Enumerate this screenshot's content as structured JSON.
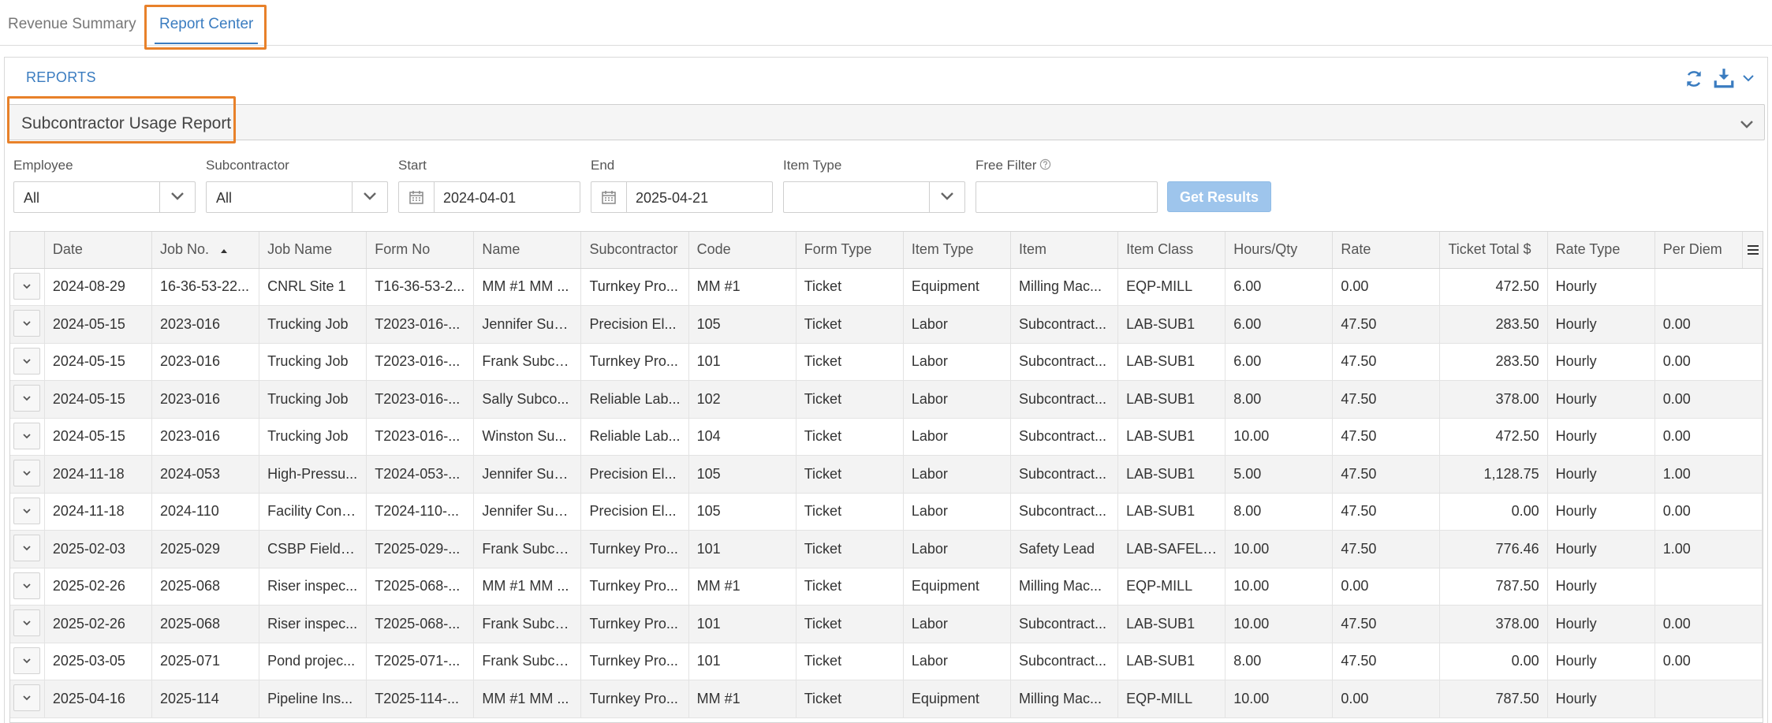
{
  "tabs": [
    {
      "label": "Revenue Summary"
    },
    {
      "label": "Report Center"
    }
  ],
  "panel": {
    "title": "REPORTS",
    "report_selected": "Subcontractor Usage Report"
  },
  "filters": {
    "employee": {
      "label": "Employee",
      "value": "All"
    },
    "subcontractor": {
      "label": "Subcontractor",
      "value": "All"
    },
    "start": {
      "label": "Start",
      "value": "2024-04-01"
    },
    "end": {
      "label": "End",
      "value": "2025-04-21"
    },
    "item_type": {
      "label": "Item Type",
      "value": ""
    },
    "free_filter": {
      "label": "Free Filter",
      "value": ""
    },
    "get_results_label": "Get Results"
  },
  "table": {
    "columns": [
      "Date",
      "Job No.",
      "Job Name",
      "Form No",
      "Name",
      "Subcontractor",
      "Code",
      "Form Type",
      "Item Type",
      "Item",
      "Item Class",
      "Hours/Qty",
      "Rate",
      "Ticket Total $",
      "Rate Type",
      "Per Diem"
    ],
    "sorted_column": "Job No.",
    "rows": [
      [
        "2024-08-29",
        "16-36-53-22...",
        "CNRL Site 1",
        "T16-36-53-2...",
        "MM #1 MM ...",
        "Turnkey Pro...",
        "MM #1",
        "Ticket",
        "Equipment",
        "Milling Mac...",
        "EQP-MILL",
        "6.00",
        "0.00",
        "472.50",
        "Hourly",
        ""
      ],
      [
        "2024-05-15",
        "2023-016",
        "Trucking Job",
        "T2023-016-...",
        "Jennifer Sub...",
        "Precision El...",
        "105",
        "Ticket",
        "Labor",
        "Subcontract...",
        "LAB-SUB1",
        "6.00",
        "47.50",
        "283.50",
        "Hourly",
        "0.00"
      ],
      [
        "2024-05-15",
        "2023-016",
        "Trucking Job",
        "T2023-016-...",
        "Frank Subco...",
        "Turnkey Pro...",
        "101",
        "Ticket",
        "Labor",
        "Subcontract...",
        "LAB-SUB1",
        "6.00",
        "47.50",
        "283.50",
        "Hourly",
        "0.00"
      ],
      [
        "2024-05-15",
        "2023-016",
        "Trucking Job",
        "T2023-016-...",
        "Sally Subco...",
        "Reliable Lab...",
        "102",
        "Ticket",
        "Labor",
        "Subcontract...",
        "LAB-SUB1",
        "8.00",
        "47.50",
        "378.00",
        "Hourly",
        "0.00"
      ],
      [
        "2024-05-15",
        "2023-016",
        "Trucking Job",
        "T2023-016-...",
        "Winston Su...",
        "Reliable Lab...",
        "104",
        "Ticket",
        "Labor",
        "Subcontract...",
        "LAB-SUB1",
        "10.00",
        "47.50",
        "472.50",
        "Hourly",
        "0.00"
      ],
      [
        "2024-11-18",
        "2024-053",
        "High-Pressu...",
        "T2024-053-...",
        "Jennifer Sub...",
        "Precision El...",
        "105",
        "Ticket",
        "Labor",
        "Subcontract...",
        "LAB-SUB1",
        "5.00",
        "47.50",
        "1,128.75",
        "Hourly",
        "1.00"
      ],
      [
        "2024-11-18",
        "2024-110",
        "Facility Cons...",
        "T2024-110-...",
        "Jennifer Sub...",
        "Precision El...",
        "105",
        "Ticket",
        "Labor",
        "Subcontract...",
        "LAB-SUB1",
        "8.00",
        "47.50",
        "0.00",
        "Hourly",
        "0.00"
      ],
      [
        "2025-02-03",
        "2025-029",
        "CSBP Field J...",
        "T2025-029-...",
        "Frank Subco...",
        "Turnkey Pro...",
        "101",
        "Ticket",
        "Labor",
        "Safety Lead",
        "LAB-SAFELE...",
        "10.00",
        "47.50",
        "776.46",
        "Hourly",
        "1.00"
      ],
      [
        "2025-02-26",
        "2025-068",
        "Riser inspec...",
        "T2025-068-...",
        "MM #1 MM ...",
        "Turnkey Pro...",
        "MM #1",
        "Ticket",
        "Equipment",
        "Milling Mac...",
        "EQP-MILL",
        "10.00",
        "0.00",
        "787.50",
        "Hourly",
        ""
      ],
      [
        "2025-02-26",
        "2025-068",
        "Riser inspec...",
        "T2025-068-...",
        "Frank Subco...",
        "Turnkey Pro...",
        "101",
        "Ticket",
        "Labor",
        "Subcontract...",
        "LAB-SUB1",
        "10.00",
        "47.50",
        "378.00",
        "Hourly",
        "0.00"
      ],
      [
        "2025-03-05",
        "2025-071",
        "Pond projec...",
        "T2025-071-...",
        "Frank Subco...",
        "Turnkey Pro...",
        "101",
        "Ticket",
        "Labor",
        "Subcontract...",
        "LAB-SUB1",
        "8.00",
        "47.50",
        "0.00",
        "Hourly",
        "0.00"
      ],
      [
        "2025-04-16",
        "2025-114",
        "Pipeline Ins...",
        "T2025-114-...",
        "MM #1 MM ...",
        "Turnkey Pro...",
        "MM #1",
        "Ticket",
        "Equipment",
        "Milling Mac...",
        "EQP-MILL",
        "10.00",
        "0.00",
        "787.50",
        "Hourly",
        ""
      ]
    ]
  },
  "colors": {
    "accent": "#3a7cc0",
    "highlight": "#e8812a",
    "button": "#9ec5ec"
  },
  "icons": [
    "refresh-icon",
    "download-icon",
    "chevron-down-icon",
    "calendar-icon",
    "help-icon",
    "sort-asc-icon",
    "column-menu-icon"
  ]
}
